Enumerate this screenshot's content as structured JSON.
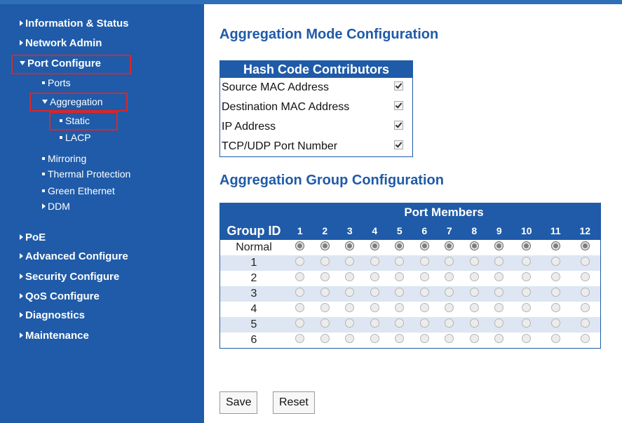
{
  "sidebar": {
    "items": [
      {
        "label": "Information & Status",
        "arrow": "right"
      },
      {
        "label": "Network Admin",
        "arrow": "right"
      },
      {
        "label": "Port Configure",
        "arrow": "down"
      },
      {
        "label": "Ports"
      },
      {
        "label": "Aggregation",
        "arrow": "down"
      },
      {
        "label": "Static"
      },
      {
        "label": "LACP"
      },
      {
        "label": "Mirroring"
      },
      {
        "label": "Thermal Protection"
      },
      {
        "label": "Green Ethernet"
      },
      {
        "label": "DDM",
        "arrow": "right"
      },
      {
        "label": "PoE",
        "arrow": "right"
      },
      {
        "label": "Advanced Configure",
        "arrow": "right"
      },
      {
        "label": "Security Configure",
        "arrow": "right"
      },
      {
        "label": "QoS Configure",
        "arrow": "right"
      },
      {
        "label": "Diagnostics",
        "arrow": "right"
      },
      {
        "label": "Maintenance",
        "arrow": "right"
      }
    ]
  },
  "mode": {
    "title": "Aggregation Mode Configuration",
    "table_header": "Hash Code Contributors",
    "rows": [
      {
        "label": "Source MAC Address",
        "checked": true
      },
      {
        "label": "Destination MAC Address",
        "checked": true
      },
      {
        "label": "IP Address",
        "checked": true
      },
      {
        "label": "TCP/UDP Port Number",
        "checked": true
      }
    ]
  },
  "group": {
    "title": "Aggregation Group Configuration",
    "port_members_label": "Port Members",
    "group_id_label": "Group ID",
    "ports": [
      "1",
      "2",
      "3",
      "4",
      "5",
      "6",
      "7",
      "8",
      "9",
      "10",
      "11",
      "12"
    ],
    "rows": [
      "Normal",
      "1",
      "2",
      "3",
      "4",
      "5",
      "6"
    ],
    "selected_row": "Normal"
  },
  "buttons": {
    "save": "Save",
    "reset": "Reset"
  },
  "colors": {
    "sidebar": "#1f5ba8",
    "accent": "#1f5ba8",
    "highlight_box": "#e02424"
  }
}
